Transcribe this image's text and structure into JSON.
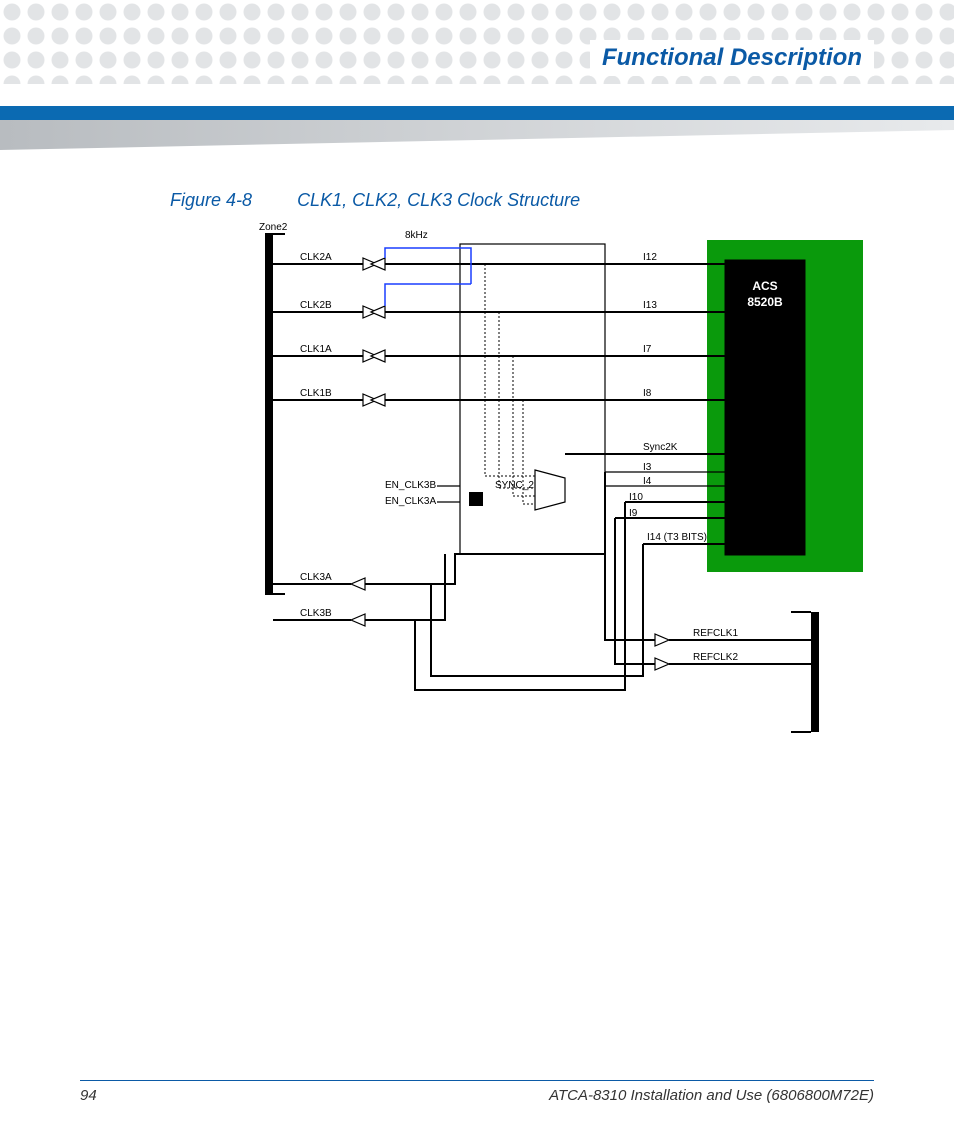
{
  "header": {
    "title": "Functional Description"
  },
  "caption": {
    "fig": "Figure 4-8",
    "title": "CLK1, CLK2, CLK3 Clock Structure"
  },
  "diagram": {
    "zone": "Zone2",
    "rate": "8kHz",
    "chip": {
      "l1": "ACS",
      "l2": "8520B"
    },
    "left_conn": [
      "CLK2A",
      "CLK2B",
      "CLK1A",
      "CLK1B",
      "CLK3A",
      "CLK3B"
    ],
    "mid": {
      "sync": "SYNC_2",
      "en3b": "EN_CLK3B",
      "en3a": "EN_CLK3A"
    },
    "right_lbls": [
      "I12",
      "I13",
      "I7",
      "I8",
      "Sync2K",
      "I3",
      "I4",
      "I10",
      "I9",
      "I14 (T3 BITS)"
    ],
    "refclk": [
      "REFCLK1",
      "REFCLK2"
    ]
  },
  "footer": {
    "page": "94",
    "doc": "ATCA-8310 Installation and Use (6806800M72E)"
  }
}
